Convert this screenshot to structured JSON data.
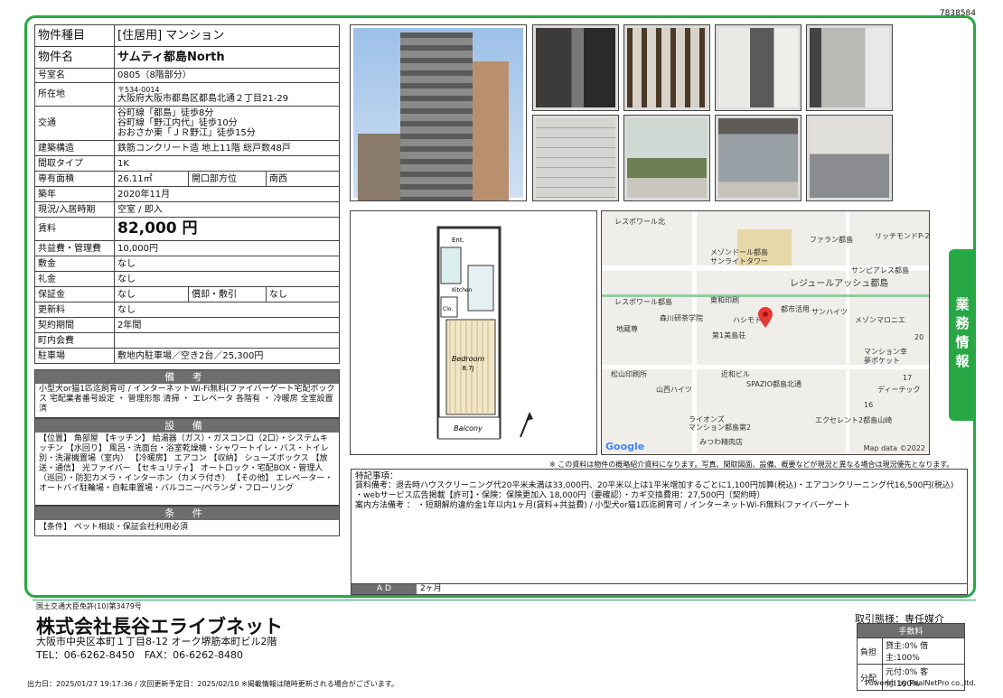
{
  "doc_id": "7838584",
  "spec": {
    "type_label": "物件種目",
    "type_value": "[住居用] マンション",
    "name_label": "物件名",
    "name_value": "サムティ都島North",
    "room_label": "号室名",
    "room_value": "0805（8階部分）",
    "addr_label": "所在地",
    "zip": "〒534-0014",
    "addr_value": "大阪府大阪市都島区都島北通２丁目21-29",
    "traffic_label": "交通",
    "traffic": [
      "谷町線「都島」徒歩8分",
      "谷町線「野江内代」徒歩10分",
      "おおさか東「ＪＲ野江」徒歩15分"
    ],
    "structure_label": "建築構造",
    "structure_value": "鉄筋コンクリート造 地上11階 総戸数48戸",
    "layout_label": "間取タイプ",
    "layout_value": "1K",
    "area_label": "専有面積",
    "area_value": "26.11㎡",
    "dir_label": "開口部方位",
    "dir_value": "南西",
    "age_label": "築年",
    "age_value": "2020年11月",
    "status_label": "現況/入居時期",
    "status_value": "空室 / 即入",
    "rent_label": "賃料",
    "rent_value": "82,000 円",
    "fee_label": "共益費・管理費",
    "fee_value": "10,000円",
    "deposit_label": "敷金",
    "deposit_value": "なし",
    "key_label": "礼金",
    "key_value": "なし",
    "guarantee_label": "保証金",
    "guarantee_value": "なし",
    "amort_label": "償却・敷引",
    "amort_value": "なし",
    "renew_label": "更新料",
    "renew_value": "なし",
    "term_label": "契約期間",
    "term_value": "2年間",
    "council_label": "町内会費",
    "council_value": "",
    "parking_label": "駐車場",
    "parking_value": "敷地内駐車場／空き2台／25,300円"
  },
  "remarks": {
    "title": "備 考",
    "text": "小型犬or猫1匹迄飼育可 / インターネットWi-Fi無料(ファイバーゲート宅配ボックス 宅配業者番号設定 ・ 管理形態 清掃 ・ エレベータ 各階有 ・ 冷暖房 全室設置済"
  },
  "equipment": {
    "title": "設 備",
    "text": "【位置】 角部屋 【キッチン】 給湯器（ガス）・ガスコンロ（2口）・システムキッチン 【水回り】 風呂・洗面台・浴室乾燥機・シャワートイレ・バス・トイレ別・洗濯機置場（室内） 【冷暖房】 エアコン 【収納】 シューズボックス 【放送・通信】 光ファイバー 【セキュリティ】 オートロック・宅配BOX・管理人（巡回）・防犯カメラ・インターホン（カメラ付き） 【その他】 エレベーター・オートバイ駐輪場・自転車置場・バルコニー/ベランダ・フローリング"
  },
  "conditions": {
    "title": "条 件",
    "text": "【条件】 ペット相談・保証会社利用必須"
  },
  "floorplan": {
    "ent": "Ent.",
    "kitchen": "Kitchen",
    "bedroom": "Bedroom",
    "size": "8.7J",
    "balcony": "Balcony",
    "clo": "Clo."
  },
  "map": {
    "labels": [
      "レスポワール北",
      "ファラン都島",
      "リッチモンドP-20",
      "メゾンドール都島",
      "サンライトタワー",
      "サンピアレス都島",
      "レジュールアッシュ都島",
      "レスポワール都島",
      "東和印刷",
      "都市活用",
      "サンハイツ",
      "森川研茶学院",
      "ハシモト",
      "メゾンマロニエ",
      "地蔵尊",
      "第1美島荘",
      "マンション幸",
      "夢ポケット",
      "松山印刷所",
      "近和ビル",
      "ディーテック",
      "SPAZIO都島北通",
      "山西ハイツ",
      "ライオンズ",
      "マンション都島第2",
      "エクセレント2都島山崎",
      "みつわ精肉店",
      "20",
      "17",
      "16"
    ],
    "google": "Google",
    "mapdata": "Map data ©2022"
  },
  "disclaimer": "※ この資料は物件の概略紹介資料になります。写真、間取図面、設備、概要などが現況と異なる場合は現況優先となります。",
  "notes": {
    "title": "特記事項：",
    "line1": "賃料備考：退去時ハウスクリーニング代20平米未満は33,000円、20平米以上は1平米増加するごとに1,100円加算(税込)・エアコンクリーニング代16,500円(税込)",
    "line2": "・webサービス広告掲載【許可】・保険：保険更加入 18,000円（要確認）・カギ交換費用：27,500円（契約時）",
    "line3": "案内方法備考 ： ・短期解約違約金1年以内1ヶ月(賃料+共益費) / 小型犬or猫1匹迄飼育可 / インターネットWi-Fi無料(ファイバーゲート"
  },
  "ad": {
    "label": "A D",
    "value": "2ヶ月"
  },
  "sidebar_tab": "業務情報",
  "company": {
    "license": "国土交通大臣免許(10)第3479号",
    "name": "株式会社長谷エライブネット",
    "address": "大阪市中央区本町１丁目8-12 オーク堺筋本町ビル2階",
    "tel": "TEL：06-6262-8450　FAX：06-6262-8480"
  },
  "transaction": {
    "label": "取引態様：専任媒介",
    "fee_title": "手数料",
    "burden_label": "負担",
    "burden_value": "貸主:0% 借主:100%",
    "split_label": "分配",
    "split_value": "元付:0% 客付:100%"
  },
  "footer": {
    "left": "出力日：2025/01/27 19:17:36 / 次回更新予定日：2025/02/10 ※掲載情報は随時更新される場合がございます。",
    "right": "Powered by RealNetPro co.,ltd."
  }
}
